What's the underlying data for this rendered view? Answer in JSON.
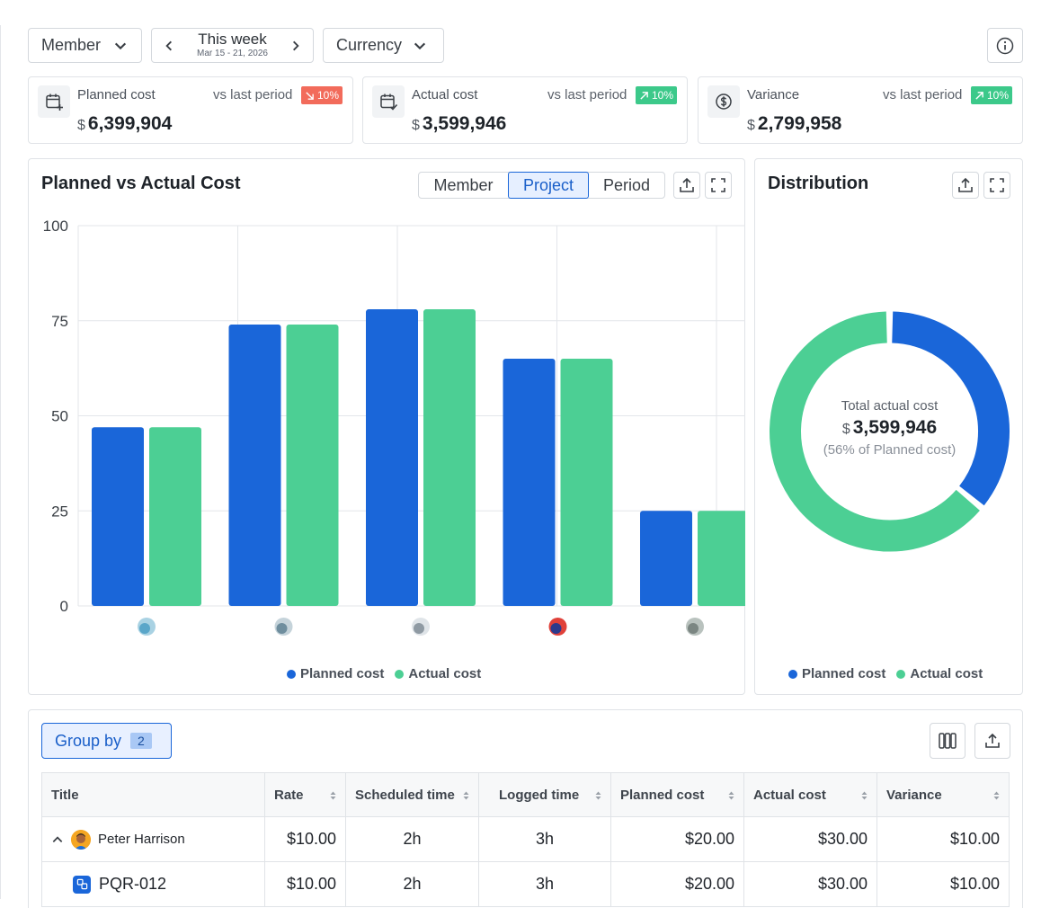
{
  "toolbar": {
    "member_label": "Member",
    "week_title": "This week",
    "week_range": "Mar 15 - 21, 2026",
    "currency_label": "Currency"
  },
  "kpis": [
    {
      "label": "Planned cost",
      "vs": "vs last period",
      "badge": "10%",
      "trend": "down",
      "badge_color": "#f26b5b",
      "currency": "$",
      "value": "6,399,904",
      "icon": "calendar-plus-icon"
    },
    {
      "label": "Actual cost",
      "vs": "vs last period",
      "badge": "10%",
      "trend": "up",
      "badge_color": "#3cc98a",
      "currency": "$",
      "value": "3,599,946",
      "icon": "calendar-check-icon"
    },
    {
      "label": "Variance",
      "vs": "vs last period",
      "badge": "10%",
      "trend": "up",
      "badge_color": "#3cc98a",
      "currency": "$",
      "value": "2,799,958",
      "icon": "dollar-circle-icon"
    }
  ],
  "bar_panel": {
    "title": "Planned vs Actual Cost",
    "tabs": [
      "Member",
      "Project",
      "Period"
    ],
    "active_tab": "Project"
  },
  "donut_panel": {
    "title": "Distribution",
    "center_label": "Total actual cost",
    "center_currency": "$",
    "center_value": "3,599,946",
    "center_note": "(56% of Planned cost)"
  },
  "colors": {
    "planned": "#1a66d9",
    "actual": "#4ccf94"
  },
  "legend": {
    "planned": "Planned cost",
    "actual": "Actual cost"
  },
  "chart_data": [
    {
      "type": "bar",
      "title": "Planned vs Actual Cost",
      "categories": [
        "avatar-1",
        "avatar-2",
        "avatar-3",
        "avatar-4",
        "avatar-5"
      ],
      "series": [
        {
          "name": "Planned cost",
          "values": [
            47,
            74,
            78,
            65,
            25
          ]
        },
        {
          "name": "Actual cost",
          "values": [
            47,
            74,
            78,
            65,
            25
          ]
        }
      ],
      "yticks": [
        0,
        25,
        50,
        75,
        100
      ],
      "ylim": [
        0,
        100
      ],
      "grid": true,
      "legend_position": "bottom"
    },
    {
      "type": "pie",
      "title": "Distribution",
      "labels": [
        "Planned cost",
        "Actual cost"
      ],
      "values": [
        36,
        64
      ],
      "legend_position": "bottom"
    }
  ],
  "table": {
    "group_by_label": "Group by",
    "group_by_count": "2",
    "columns": [
      "Title",
      "Rate",
      "Scheduled time",
      "Logged time",
      "Planned cost",
      "Actual cost",
      "Variance"
    ],
    "rows": [
      {
        "title": "Peter Harrison",
        "rate": "$10.00",
        "scheduled": "2h",
        "logged": "3h",
        "planned": "$20.00",
        "actual": "$30.00",
        "variance": "$10.00"
      },
      {
        "title": "PQR-012",
        "rate": "$10.00",
        "scheduled": "2h",
        "logged": "3h",
        "planned": "$20.00",
        "actual": "$30.00",
        "variance": "$10.00"
      }
    ]
  }
}
